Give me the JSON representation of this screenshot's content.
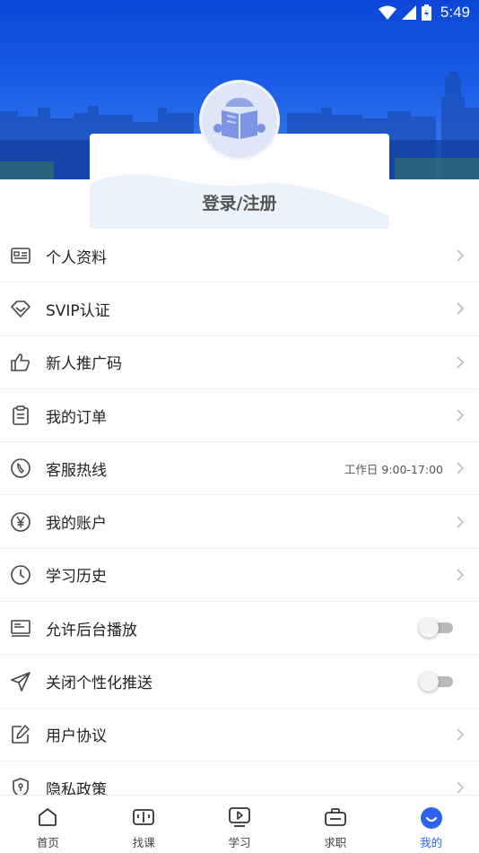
{
  "status_bar": {
    "time": "5:49"
  },
  "profile": {
    "login_label": "登录/注册"
  },
  "menu": [
    {
      "label": "个人资料",
      "icon": "id-card-icon",
      "control": "chevron"
    },
    {
      "label": "SVIP认证",
      "icon": "diamond-icon",
      "control": "chevron"
    },
    {
      "label": "新人推广码",
      "icon": "thumbs-up-icon",
      "control": "chevron"
    },
    {
      "label": "我的订单",
      "icon": "clipboard-icon",
      "control": "chevron"
    },
    {
      "label": "客服热线",
      "icon": "phone-icon",
      "control": "chevron",
      "extra": "工作日 9:00-17:00"
    },
    {
      "label": "我的账户",
      "icon": "yen-icon",
      "control": "chevron"
    },
    {
      "label": "学习历史",
      "icon": "clock-icon",
      "control": "chevron"
    },
    {
      "label": "允许后台播放",
      "icon": "player-icon",
      "control": "toggle",
      "on": false
    },
    {
      "label": "关闭个性化推送",
      "icon": "send-icon",
      "control": "toggle",
      "on": false
    },
    {
      "label": "用户协议",
      "icon": "edit-icon",
      "control": "chevron"
    },
    {
      "label": "隐私政策",
      "icon": "shield-icon",
      "control": "chevron"
    }
  ],
  "tabs": [
    {
      "label": "首页",
      "icon": "home-icon",
      "active": false
    },
    {
      "label": "找课",
      "icon": "book-icon",
      "active": false
    },
    {
      "label": "学习",
      "icon": "play-screen-icon",
      "active": false
    },
    {
      "label": "求职",
      "icon": "briefcase-icon",
      "active": false
    },
    {
      "label": "我的",
      "icon": "smile-icon",
      "active": true
    }
  ],
  "colors": {
    "accent": "#2b62f0",
    "header": "#1a5ce6"
  }
}
